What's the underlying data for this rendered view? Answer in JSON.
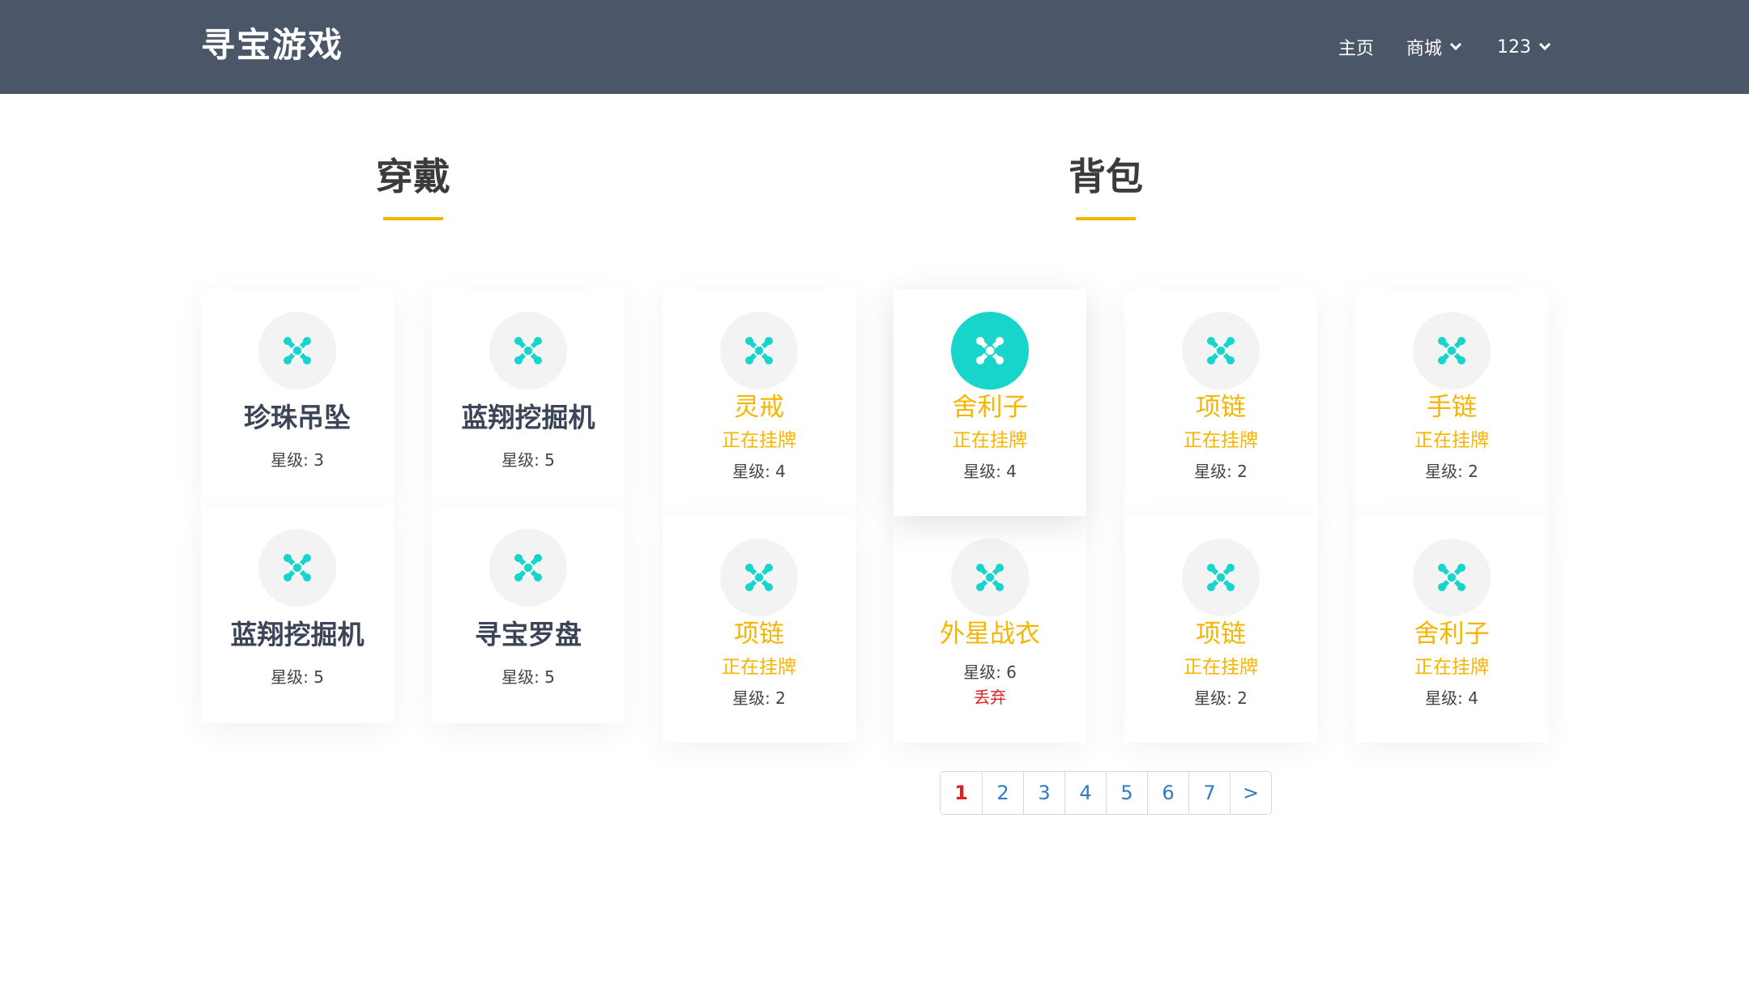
{
  "app": {
    "brand": "寻宝游戏"
  },
  "nav": {
    "home": "主页",
    "shop": "商城",
    "user": "123"
  },
  "sections": {
    "worn": "穿戴",
    "bag": "背包"
  },
  "colors": {
    "header_bg": "#4b5668",
    "accent": "#f7b500",
    "icon_teal": "#17d5cb",
    "danger": "#e02020",
    "link": "#3479c0"
  },
  "worn": [
    {
      "name": "珍珠吊坠",
      "star": "星级: 3",
      "icon": "joomla-icon"
    },
    {
      "name": "蓝翔挖掘机",
      "star": "星级: 5",
      "icon": "joomla-icon"
    },
    {
      "name": "蓝翔挖掘机",
      "star": "星级: 5",
      "icon": "joomla-icon"
    },
    {
      "name": "寻宝罗盘",
      "star": "星级: 5",
      "icon": "joomla-icon"
    }
  ],
  "bag": [
    {
      "name": "灵戒",
      "status": "正在挂牌",
      "star": "星级: 4"
    },
    {
      "name": "舍利子",
      "status": "正在挂牌",
      "star": "星级: 4"
    },
    {
      "name": "项链",
      "status": "正在挂牌",
      "star": "星级: 2"
    },
    {
      "name": "手链",
      "status": "正在挂牌",
      "star": "星级: 2"
    },
    {
      "name": "项链",
      "status": "正在挂牌",
      "star": "星级: 2"
    },
    {
      "name": "外星战衣",
      "star": "星级: 6",
      "action": "丢弃"
    },
    {
      "name": "项链",
      "status": "正在挂牌",
      "star": "星级: 2"
    },
    {
      "name": "舍利子",
      "status": "正在挂牌",
      "star": "星级: 4"
    }
  ],
  "pagination": {
    "pages": [
      "1",
      "2",
      "3",
      "4",
      "5",
      "6",
      "7"
    ],
    "next": ">",
    "current": "1"
  }
}
